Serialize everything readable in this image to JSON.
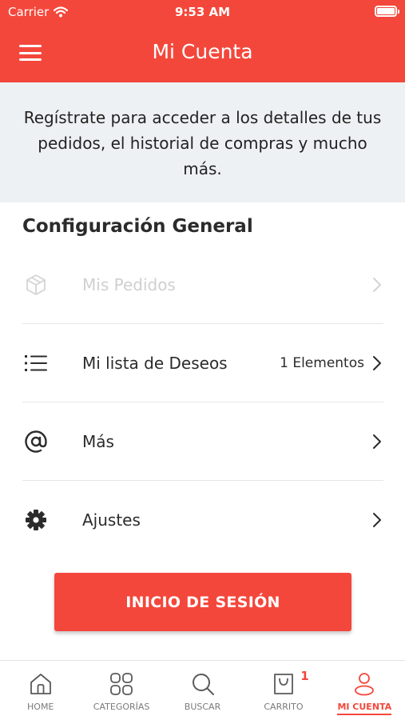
{
  "status_bar": {
    "carrier": "Carrier",
    "time": "9:53 AM"
  },
  "nav": {
    "title": "Mi Cuenta",
    "menu_icon": "hamburger-menu-icon"
  },
  "banner": {
    "text": "Regístrate para acceder a los detalles de tus pedidos, el historial de compras y mucho más."
  },
  "section": {
    "title": "Configuración General"
  },
  "menu_items": [
    {
      "label": "Mis Pedidos",
      "value": "",
      "icon": "box-icon",
      "enabled": false
    },
    {
      "label": "Mi lista de Deseos",
      "value": "1 Elementos",
      "icon": "list-icon",
      "enabled": true
    },
    {
      "label": "Más",
      "value": "",
      "icon": "at-icon",
      "enabled": true
    },
    {
      "label": "Ajustes",
      "value": "",
      "icon": "gear-icon",
      "enabled": true
    }
  ],
  "login_button": {
    "label": "INICIO DE SESIÓN"
  },
  "tabbar": {
    "tabs": [
      {
        "label": "HOME",
        "icon": "home-icon",
        "active": false
      },
      {
        "label": "CATEGORÍAS",
        "icon": "grid-icon",
        "active": false
      },
      {
        "label": "BUSCAR",
        "icon": "search-icon",
        "active": false
      },
      {
        "label": "CARRITO",
        "icon": "bag-icon",
        "active": false,
        "badge": "1"
      },
      {
        "label": "MI CUENTA",
        "icon": "user-icon",
        "active": true
      }
    ]
  },
  "colors": {
    "accent": "#f4473b",
    "banner_bg": "#eef1f3",
    "text": "#2b2b2b",
    "disabled": "#cfcfcf"
  }
}
